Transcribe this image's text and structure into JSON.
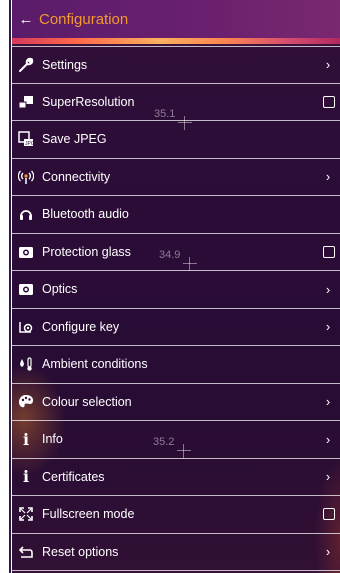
{
  "header": {
    "back_icon": "arrow-left-icon",
    "title": "Configuration"
  },
  "colors": {
    "accent": "#f39a2a",
    "header_bg": "#6a206e",
    "text": "#ffffff"
  },
  "menu": {
    "items": [
      {
        "label": "Settings",
        "icon": "wrench-icon",
        "control": "chevron"
      },
      {
        "label": "SuperResolution",
        "icon": "superresolution-icon",
        "control": "checkbox",
        "checked": false
      },
      {
        "label": "Save JPEG",
        "icon": "jpeg-icon",
        "control": "none"
      },
      {
        "label": "Connectivity",
        "icon": "wireless-icon",
        "control": "chevron"
      },
      {
        "label": "Bluetooth audio",
        "icon": "headphones-icon",
        "control": "none"
      },
      {
        "label": "Protection glass",
        "icon": "camera-icon",
        "control": "checkbox",
        "checked": false
      },
      {
        "label": "Optics",
        "icon": "camera-icon",
        "control": "chevron"
      },
      {
        "label": "Configure key",
        "icon": "key-config-icon",
        "control": "chevron"
      },
      {
        "label": "Ambient conditions",
        "icon": "humidity-temperature-icon",
        "control": "none"
      },
      {
        "label": "Colour selection",
        "icon": "palette-icon",
        "control": "chevron"
      },
      {
        "label": "Info",
        "icon": "info-icon",
        "control": "chevron"
      },
      {
        "label": "Certificates",
        "icon": "info-icon",
        "control": "chevron"
      },
      {
        "label": "Fullscreen mode",
        "icon": "fullscreen-icon",
        "control": "checkbox",
        "checked": false
      },
      {
        "label": "Reset options",
        "icon": "reset-icon",
        "control": "chevron"
      }
    ]
  },
  "overlay_readings": [
    "35.1",
    "34.9",
    "35.2"
  ]
}
